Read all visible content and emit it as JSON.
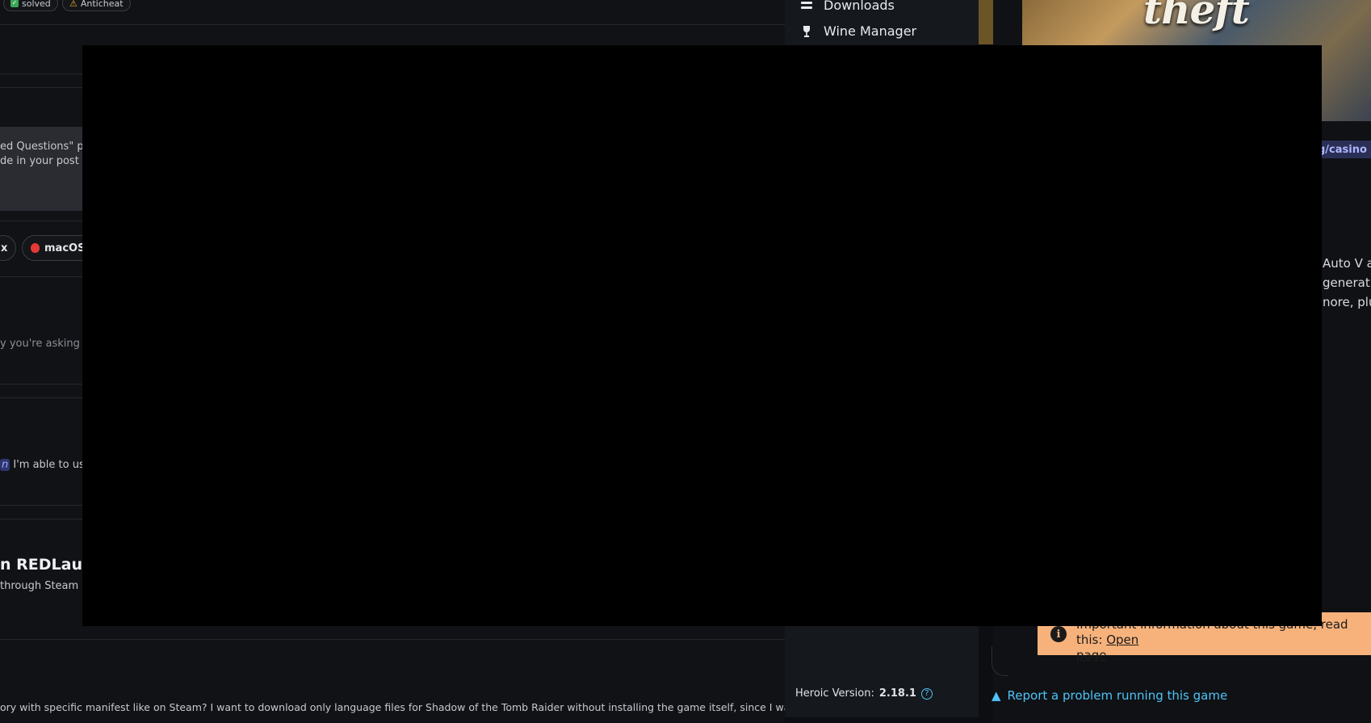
{
  "forum": {
    "tags": [
      "solved",
      "Anticheat"
    ],
    "info_lines": [
      "ed Questions\" po",
      "de in your post so"
    ],
    "os_tags": [
      "x",
      "macOS"
    ],
    "hint_text": "y you're asking fo",
    "mention_text": "n",
    "mention_tail": " I'm able to use",
    "thread_title": "n REDLaunc",
    "thread_snippet": " through Steam s",
    "bottom_text": "ory with specific manifest like on Steam? I want to download only language files for Shadow of the Tomb Raider without installing the game itself, since I want to arc"
  },
  "sidebar": {
    "items": [
      {
        "label": "Downloads",
        "icon": "downloads-icon"
      },
      {
        "label": "Wine Manager",
        "icon": "wine-glass-icon"
      }
    ],
    "version_label": "Heroic Version:",
    "version_value": "2.18.1",
    "help_glyph": "?"
  },
  "game": {
    "cover_text": "theft",
    "genre_tag": "g/casino",
    "description_lines": [
      "Auto V an",
      "generatio",
      "nore, plus"
    ],
    "notice_text": "Important information about this game, read this: ",
    "notice_link": "Open",
    "notice_link2": "page",
    "report_label": "Report a problem running this game"
  },
  "colors": {
    "accent": "#4fc3f7",
    "notice_bg": "#f7b27b",
    "genre_bg": "#2a2f55"
  }
}
